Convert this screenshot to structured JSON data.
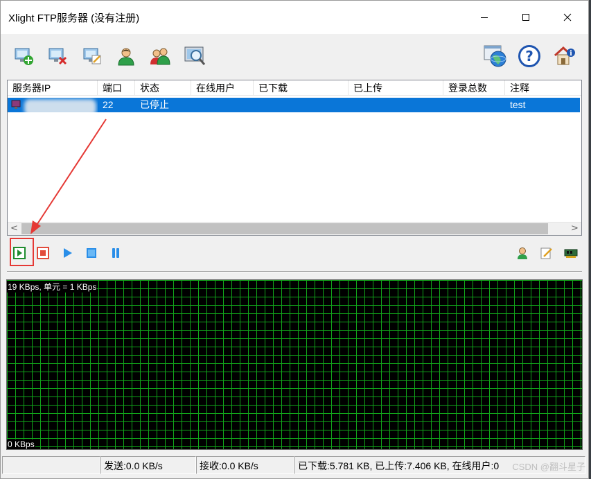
{
  "window": {
    "title": "Xlight FTP服务器 (没有注册)"
  },
  "toolbar": {
    "buttons": [
      {
        "icon": "add-server-icon"
      },
      {
        "icon": "delete-server-icon"
      },
      {
        "icon": "edit-server-icon"
      },
      {
        "icon": "user-icon"
      },
      {
        "icon": "users-icon"
      },
      {
        "icon": "search-icon"
      },
      {
        "icon": "web-globe-icon"
      },
      {
        "icon": "help-icon"
      },
      {
        "icon": "home-info-icon"
      }
    ]
  },
  "server_list": {
    "columns": [
      "服务器IP",
      "端口",
      "状态",
      "在线用户",
      "已下载",
      "已上传",
      "登录总数",
      "注释"
    ],
    "rows": [
      {
        "ip": "",
        "port": "22",
        "status": "已停止",
        "online_users": "",
        "downloaded": "",
        "uploaded": "",
        "logins": "",
        "note": "test"
      }
    ],
    "scroll_left": "<",
    "scroll_right": ">"
  },
  "graph": {
    "top_label": "19 KBps, 单元 = 1 KBps",
    "bottom_label": "0 KBps"
  },
  "statusbar": {
    "send": "发送:0.0 KB/s",
    "receive": "接收:0.0 KB/s",
    "totals": "已下载:5.781 KB, 已上传:7.406 KB, 在线用户:0"
  },
  "watermark": "CSDN @翻斗星子",
  "colors": {
    "selection": "#0a76d8",
    "graph_grid": "#11a61a",
    "annotation": "#e53935"
  }
}
